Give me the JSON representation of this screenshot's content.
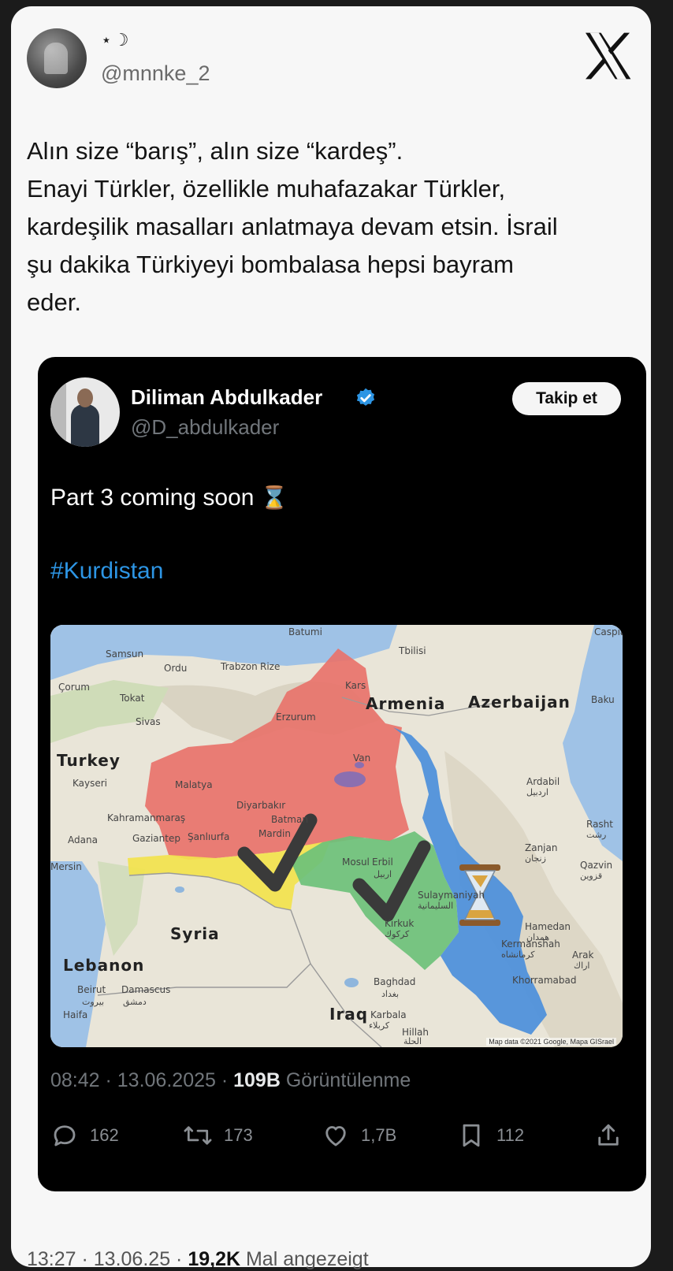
{
  "author": {
    "display_name": "⋆☽",
    "handle": "@mnnke_2"
  },
  "tweet_lines": [
    "Alın size “barış”, alın size “kardeş”.",
    "Enayi Türkler, özellikle muhafazakar Türkler,",
    "kardeşilik masalları anlatmaya devam etsin. İsrail",
    "şu dakika Türkiyeyi bombalasa hepsi bayram",
    "eder."
  ],
  "quoted": {
    "display_name": "Diliman Abdulkader",
    "handle": "@D_abdulkader",
    "follow_label": "Takip et",
    "text": "Part 3 coming soon",
    "emoji": "⌛",
    "hashtag": "#Kurdistan",
    "map": {
      "countries": [
        "Turkey",
        "Syria",
        "Lebanon",
        "Iraq",
        "Armenia",
        "Azerbaijan"
      ],
      "cities": [
        "Batumi",
        "Samsun",
        "Ordu",
        "Trabzon",
        "Rize",
        "Tbilisi",
        "Çorum",
        "Tokat",
        "Sivas",
        "Kars",
        "Erzurum",
        "Baku",
        "Kayseri",
        "Malatya",
        "Van",
        "Ardabil",
        "Diyarbakır",
        "Batman",
        "Kahramanmaraş",
        "Mardin",
        "Rasht",
        "Adana",
        "Gaziantep",
        "Şanlıurfa",
        "Zanjan",
        "Mersin",
        "Mosul",
        "Erbil",
        "Qazvin",
        "Sulaymaniyah",
        "Kirkuk",
        "Hamedan",
        "Kermanshah",
        "Arak",
        "Beirut",
        "Damascus",
        "Baghdad",
        "Khorramabad",
        "Haifa",
        "Karbala",
        "Hillah",
        "Caspia"
      ],
      "arabic_labels": [
        "دمشق",
        "بيروت",
        "بغداد",
        "كربلاء",
        "الحلة",
        "اربيل",
        "كركوك",
        "السليمانية",
        "همدان",
        "كرمانشاه",
        "اراك",
        "اردبيل",
        "رشت",
        "قزوين",
        "زنجان"
      ],
      "credit": "Map data ©2021 Google, Mapa GISrael"
    },
    "time": "08:42 · 13.06.2025 · ",
    "views_count": "109B",
    "views_label": "Görüntülenme",
    "replies": "162",
    "reposts": "173",
    "likes": "1,7B",
    "bookmarks": "112"
  },
  "footer": {
    "time": "13:27 · 13.06.25 · ",
    "views_count": "19,2K",
    "views_label": "Mal angezeigt"
  },
  "colors": {
    "red_region": "#e8736b",
    "yellow_region": "#f2e34d",
    "green_region": "#6cc17a",
    "blue_region": "#4b8fdb",
    "link": "#2d95e4",
    "verified": "#2d95e4"
  }
}
